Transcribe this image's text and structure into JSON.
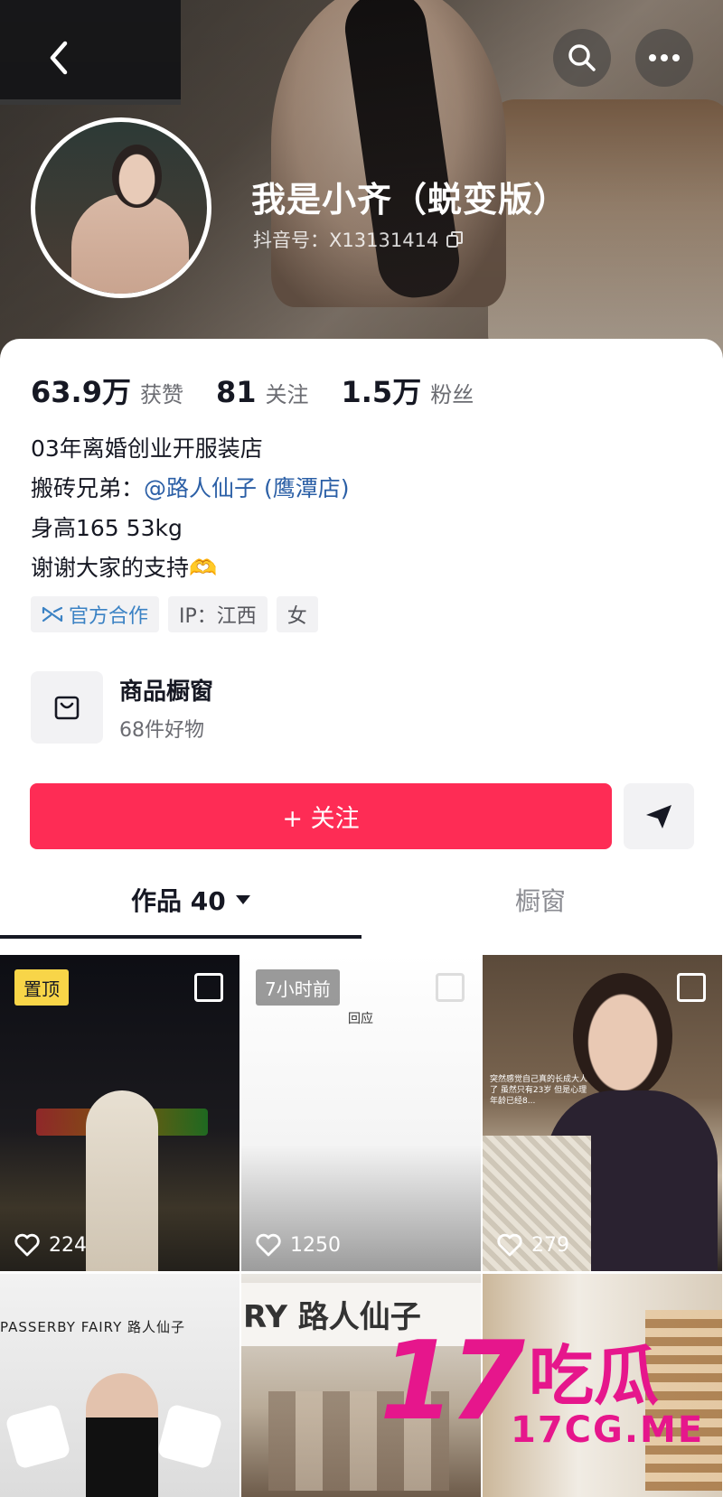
{
  "header": {
    "nickname": "我是小齐（蜕变版）",
    "douyin_id": "抖音号：X13131414"
  },
  "stats": [
    {
      "num": "63.9万",
      "label": "获赞"
    },
    {
      "num": "81",
      "label": "关注"
    },
    {
      "num": "1.5万",
      "label": "粉丝"
    }
  ],
  "bio": {
    "line1": "03年离婚创业开服装店",
    "line2_prefix": "搬砖兄弟：",
    "line2_mention": "@路人仙子 (鹰潭店)",
    "line3": "身高165 53kg",
    "line4": "谢谢大家的支持🫶"
  },
  "tags": {
    "official": "官方合作",
    "ip": "IP：江西",
    "gender": "女"
  },
  "shop": {
    "title": "商品橱窗",
    "subtitle": "68件好物"
  },
  "follow_label": "+ 关注",
  "tabs": {
    "works": "作品 40",
    "window": "橱窗"
  },
  "videos": [
    {
      "badge": "置顶",
      "likes": "224"
    },
    {
      "badge": "7小时前",
      "likes": "1250",
      "caption": "回应"
    },
    {
      "badge": "",
      "likes": "279",
      "caption": "突然感觉自己真的长成大人了 虽然只有23岁 但是心理年龄已经8..."
    }
  ],
  "videos_row2": [
    {
      "caption": "PASSERBY FAIRY 路人仙子"
    },
    {
      "caption": "RY 路人仙子"
    },
    {
      "caption": ""
    }
  ],
  "watermark": {
    "big": "17",
    "cn": "吃瓜",
    "sub": "17CG.ME"
  },
  "colors": {
    "accent": "#fe2c55",
    "mention": "#2b5fa6",
    "pin_badge": "#f8d548"
  }
}
